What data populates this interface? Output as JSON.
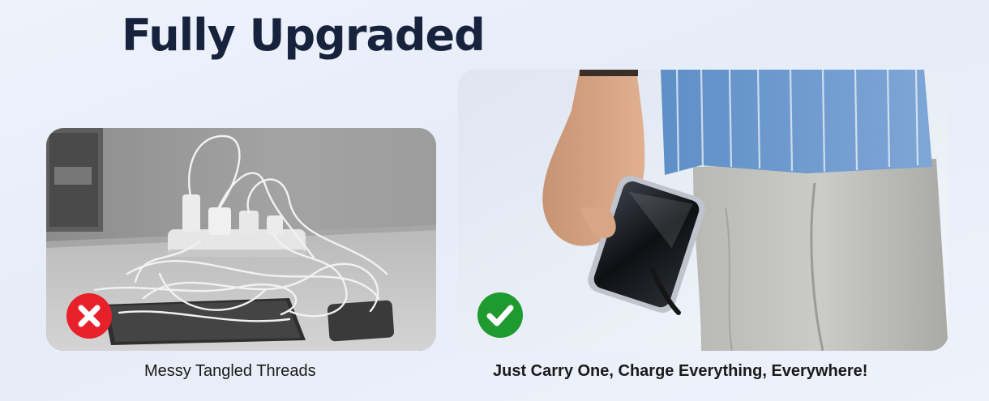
{
  "headline": "Fully Upgraded",
  "comparison": {
    "before": {
      "caption": "Messy Tangled Threads",
      "badge_icon": "cross-icon",
      "badge_color": "#e8202a"
    },
    "after": {
      "caption": "Just Carry One, Charge Everything, Everywhere!",
      "badge_icon": "check-icon",
      "badge_color": "#1f9a2e"
    }
  }
}
